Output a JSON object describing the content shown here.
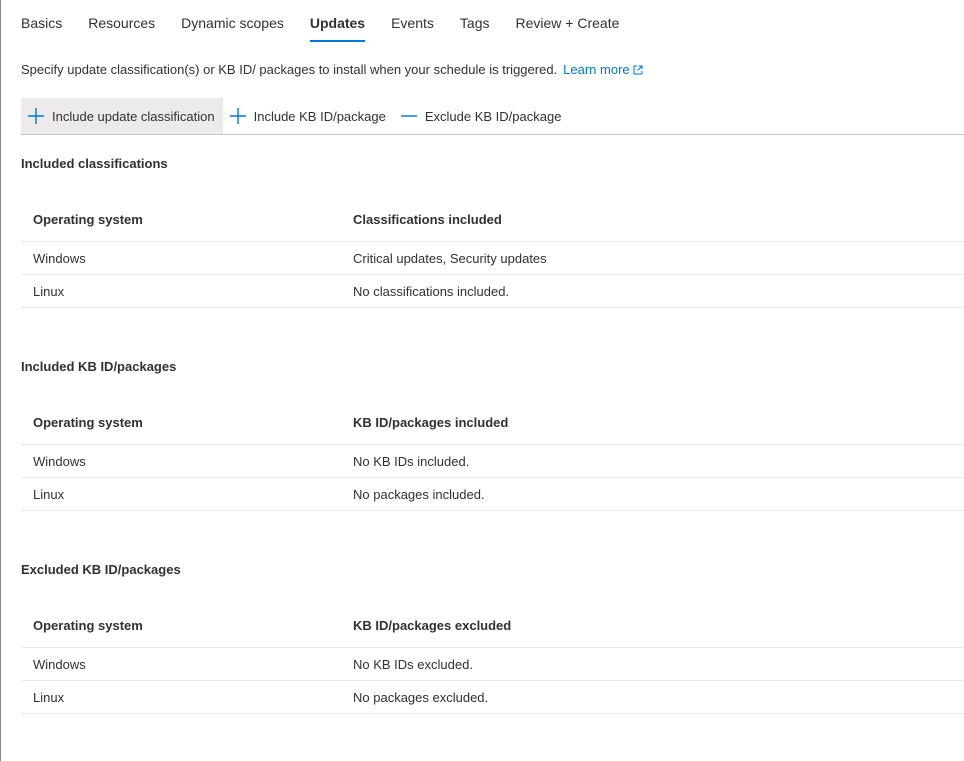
{
  "tabs": [
    {
      "label": "Basics"
    },
    {
      "label": "Resources"
    },
    {
      "label": "Dynamic scopes"
    },
    {
      "label": "Updates"
    },
    {
      "label": "Events"
    },
    {
      "label": "Tags"
    },
    {
      "label": "Review + Create"
    }
  ],
  "active_tab": "Updates",
  "description": {
    "text": "Specify update classification(s) or KB ID/ packages to install when your schedule is triggered.",
    "link": "Learn more"
  },
  "toolbar": {
    "include_classification": "Include update classification",
    "include_kb": "Include KB ID/package",
    "exclude_kb": "Exclude KB ID/package"
  },
  "sections": {
    "classifications": {
      "title": "Included classifications",
      "headers": [
        "Operating system",
        "Classifications included"
      ],
      "rows": [
        [
          "Windows",
          "Critical updates, Security updates"
        ],
        [
          "Linux",
          "No classifications included."
        ]
      ]
    },
    "included_kb": {
      "title": "Included KB ID/packages",
      "headers": [
        "Operating system",
        "KB ID/packages included"
      ],
      "rows": [
        [
          "Windows",
          "No KB IDs included."
        ],
        [
          "Linux",
          "No packages included."
        ]
      ]
    },
    "excluded_kb": {
      "title": "Excluded KB ID/packages",
      "headers": [
        "Operating system",
        "KB ID/packages excluded"
      ],
      "rows": [
        [
          "Windows",
          "No KB IDs excluded."
        ],
        [
          "Linux",
          "No packages excluded."
        ]
      ]
    }
  },
  "colors": {
    "accent": "#0078d4",
    "text": "#323130",
    "divider": "#edebe9"
  }
}
